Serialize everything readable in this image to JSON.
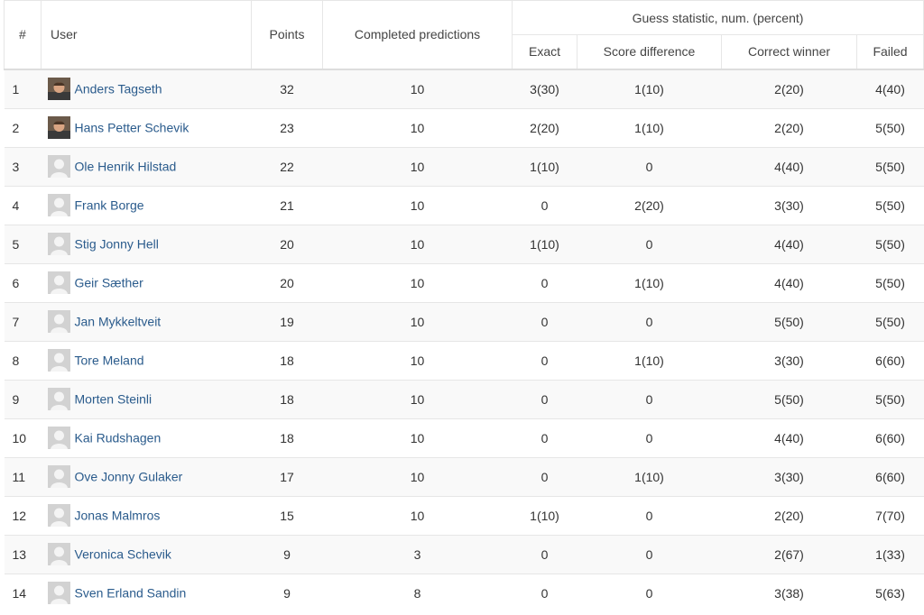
{
  "headers": {
    "rank": "#",
    "user": "User",
    "points": "Points",
    "completed": "Completed predictions",
    "group": "Guess statistic, num. (percent)",
    "exact": "Exact",
    "score_diff": "Score difference",
    "correct_winner": "Correct winner",
    "failed": "Failed"
  },
  "rows": [
    {
      "rank": "1",
      "name": "Anders Tagseth",
      "avatar": "photo",
      "points": "32",
      "completed": "10",
      "exact": "3(30)",
      "score_diff": "1(10)",
      "correct_winner": "2(20)",
      "failed": "4(40)"
    },
    {
      "rank": "2",
      "name": "Hans Petter Schevik",
      "avatar": "photo",
      "points": "23",
      "completed": "10",
      "exact": "2(20)",
      "score_diff": "1(10)",
      "correct_winner": "2(20)",
      "failed": "5(50)"
    },
    {
      "rank": "3",
      "name": "Ole Henrik Hilstad",
      "avatar": "default",
      "points": "22",
      "completed": "10",
      "exact": "1(10)",
      "score_diff": "0",
      "correct_winner": "4(40)",
      "failed": "5(50)"
    },
    {
      "rank": "4",
      "name": "Frank Borge",
      "avatar": "default",
      "points": "21",
      "completed": "10",
      "exact": "0",
      "score_diff": "2(20)",
      "correct_winner": "3(30)",
      "failed": "5(50)"
    },
    {
      "rank": "5",
      "name": "Stig Jonny Hell",
      "avatar": "default",
      "points": "20",
      "completed": "10",
      "exact": "1(10)",
      "score_diff": "0",
      "correct_winner": "4(40)",
      "failed": "5(50)"
    },
    {
      "rank": "6",
      "name": "Geir Sæther",
      "avatar": "default",
      "points": "20",
      "completed": "10",
      "exact": "0",
      "score_diff": "1(10)",
      "correct_winner": "4(40)",
      "failed": "5(50)"
    },
    {
      "rank": "7",
      "name": "Jan Mykkeltveit",
      "avatar": "default",
      "points": "19",
      "completed": "10",
      "exact": "0",
      "score_diff": "0",
      "correct_winner": "5(50)",
      "failed": "5(50)"
    },
    {
      "rank": "8",
      "name": "Tore Meland",
      "avatar": "default",
      "points": "18",
      "completed": "10",
      "exact": "0",
      "score_diff": "1(10)",
      "correct_winner": "3(30)",
      "failed": "6(60)"
    },
    {
      "rank": "9",
      "name": "Morten Steinli",
      "avatar": "default",
      "points": "18",
      "completed": "10",
      "exact": "0",
      "score_diff": "0",
      "correct_winner": "5(50)",
      "failed": "5(50)"
    },
    {
      "rank": "10",
      "name": "Kai Rudshagen",
      "avatar": "default",
      "points": "18",
      "completed": "10",
      "exact": "0",
      "score_diff": "0",
      "correct_winner": "4(40)",
      "failed": "6(60)"
    },
    {
      "rank": "11",
      "name": "Ove Jonny Gulaker",
      "avatar": "default",
      "points": "17",
      "completed": "10",
      "exact": "0",
      "score_diff": "1(10)",
      "correct_winner": "3(30)",
      "failed": "6(60)"
    },
    {
      "rank": "12",
      "name": "Jonas Malmros",
      "avatar": "default",
      "points": "15",
      "completed": "10",
      "exact": "1(10)",
      "score_diff": "0",
      "correct_winner": "2(20)",
      "failed": "7(70)"
    },
    {
      "rank": "13",
      "name": "Veronica Schevik",
      "avatar": "default",
      "points": "9",
      "completed": "3",
      "exact": "0",
      "score_diff": "0",
      "correct_winner": "2(67)",
      "failed": "1(33)"
    },
    {
      "rank": "14",
      "name": "Sven Erland Sandin",
      "avatar": "default",
      "points": "9",
      "completed": "8",
      "exact": "0",
      "score_diff": "0",
      "correct_winner": "3(38)",
      "failed": "5(63)"
    }
  ],
  "colors": {
    "link": "#2a5b8c",
    "stripe": "#f9f9f9",
    "border": "#e6e6e6"
  }
}
